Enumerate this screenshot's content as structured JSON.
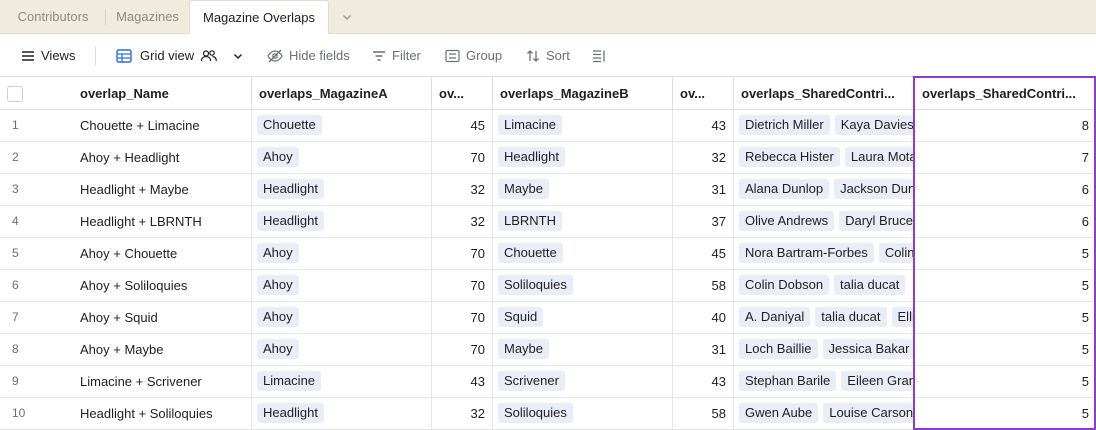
{
  "tabs": [
    {
      "label": "Contributors"
    },
    {
      "label": "Magazines"
    },
    {
      "label": "Magazine Overlaps"
    }
  ],
  "toolbar": {
    "views_label": "Views",
    "grid_view_label": "Grid view",
    "hide_fields_label": "Hide fields",
    "filter_label": "Filter",
    "group_label": "Group",
    "sort_label": "Sort"
  },
  "columns": [
    "overlap_Name",
    "overlaps_MagazineA",
    "ov...",
    "overlaps_MagazineB",
    "ov...",
    "overlaps_SharedContri...",
    "overlaps_SharedContri..."
  ],
  "rows": [
    {
      "n": "1",
      "name": "Chouette + Limacine",
      "magA": "Chouette",
      "a": "45",
      "magB": "Limacine",
      "b": "43",
      "shared": [
        "Dietrich Miller",
        "Kaya Davies"
      ],
      "count": "8"
    },
    {
      "n": "2",
      "name": "Ahoy + Headlight",
      "magA": "Ahoy",
      "a": "70",
      "magB": "Headlight",
      "b": "32",
      "shared": [
        "Rebecca Hister",
        "Laura Mota-"
      ],
      "count": "7"
    },
    {
      "n": "3",
      "name": "Headlight + Maybe",
      "magA": "Headlight",
      "a": "32",
      "magB": "Maybe",
      "b": "31",
      "shared": [
        "Alana Dunlop",
        "Jackson Dunn"
      ],
      "count": "6"
    },
    {
      "n": "4",
      "name": "Headlight + LBRNTH",
      "magA": "Headlight",
      "a": "32",
      "magB": "LBRNTH",
      "b": "37",
      "shared": [
        "Olive Andrews",
        "Daryl Bruce"
      ],
      "count": "6"
    },
    {
      "n": "5",
      "name": "Ahoy + Chouette",
      "magA": "Ahoy",
      "a": "70",
      "magB": "Chouette",
      "b": "45",
      "shared": [
        "Nora Bartram-Forbes",
        "Colin"
      ],
      "count": "5"
    },
    {
      "n": "6",
      "name": "Ahoy + Soliloquies",
      "magA": "Ahoy",
      "a": "70",
      "magB": "Soliloquies",
      "b": "58",
      "shared": [
        "Colin Dobson",
        "talia ducat"
      ],
      "count": "5"
    },
    {
      "n": "7",
      "name": "Ahoy + Squid",
      "magA": "Ahoy",
      "a": "70",
      "magB": "Squid",
      "b": "40",
      "shared": [
        "A. Daniyal",
        "talia ducat",
        "Ellie"
      ],
      "count": "5"
    },
    {
      "n": "8",
      "name": "Ahoy + Maybe",
      "magA": "Ahoy",
      "a": "70",
      "magB": "Maybe",
      "b": "31",
      "shared": [
        "Loch Baillie",
        "Jessica Bakar"
      ],
      "count": "5"
    },
    {
      "n": "9",
      "name": "Limacine + Scrivener",
      "magA": "Limacine",
      "a": "43",
      "magB": "Scrivener",
      "b": "43",
      "shared": [
        "Stephan Barile",
        "Eileen Grant"
      ],
      "count": "5"
    },
    {
      "n": "10",
      "name": "Headlight + Soliloquies",
      "magA": "Headlight",
      "a": "32",
      "magB": "Soliloquies",
      "b": "58",
      "shared": [
        "Gwen Aube",
        "Louise Carson"
      ],
      "count": "5"
    }
  ],
  "colors": {
    "tabbar_bg": "#f0ecdd",
    "chip_bg": "#e9edf5",
    "selection": "#8e3bd6",
    "grid_icon": "#2d6fd6"
  },
  "icons": [
    "list-icon",
    "grid-view-icon",
    "people-icon",
    "chevron-down-icon",
    "eye-slash-icon",
    "filter-icon",
    "group-icon",
    "sort-icon",
    "row-height-icon"
  ]
}
